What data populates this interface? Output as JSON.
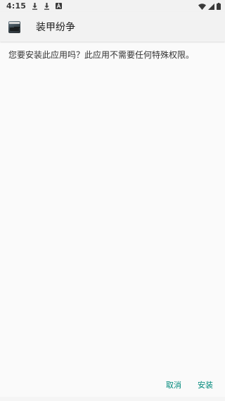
{
  "status_bar": {
    "time": "4:15",
    "icons_left": [
      "download-icon",
      "download-icon",
      "notification-a-icon"
    ],
    "icons_right": [
      "wifi-icon",
      "signal-icon",
      "battery-icon"
    ]
  },
  "header": {
    "app_icon": "app-icon",
    "title": "装甲纷争"
  },
  "body": {
    "prompt": "您要安装此应用吗？此应用不需要任何特殊权限。"
  },
  "actions": {
    "cancel_label": "取消",
    "install_label": "安装"
  },
  "colors": {
    "accent": "#00897b",
    "background": "#fafafa",
    "header_bg": "#f2f2f2"
  }
}
